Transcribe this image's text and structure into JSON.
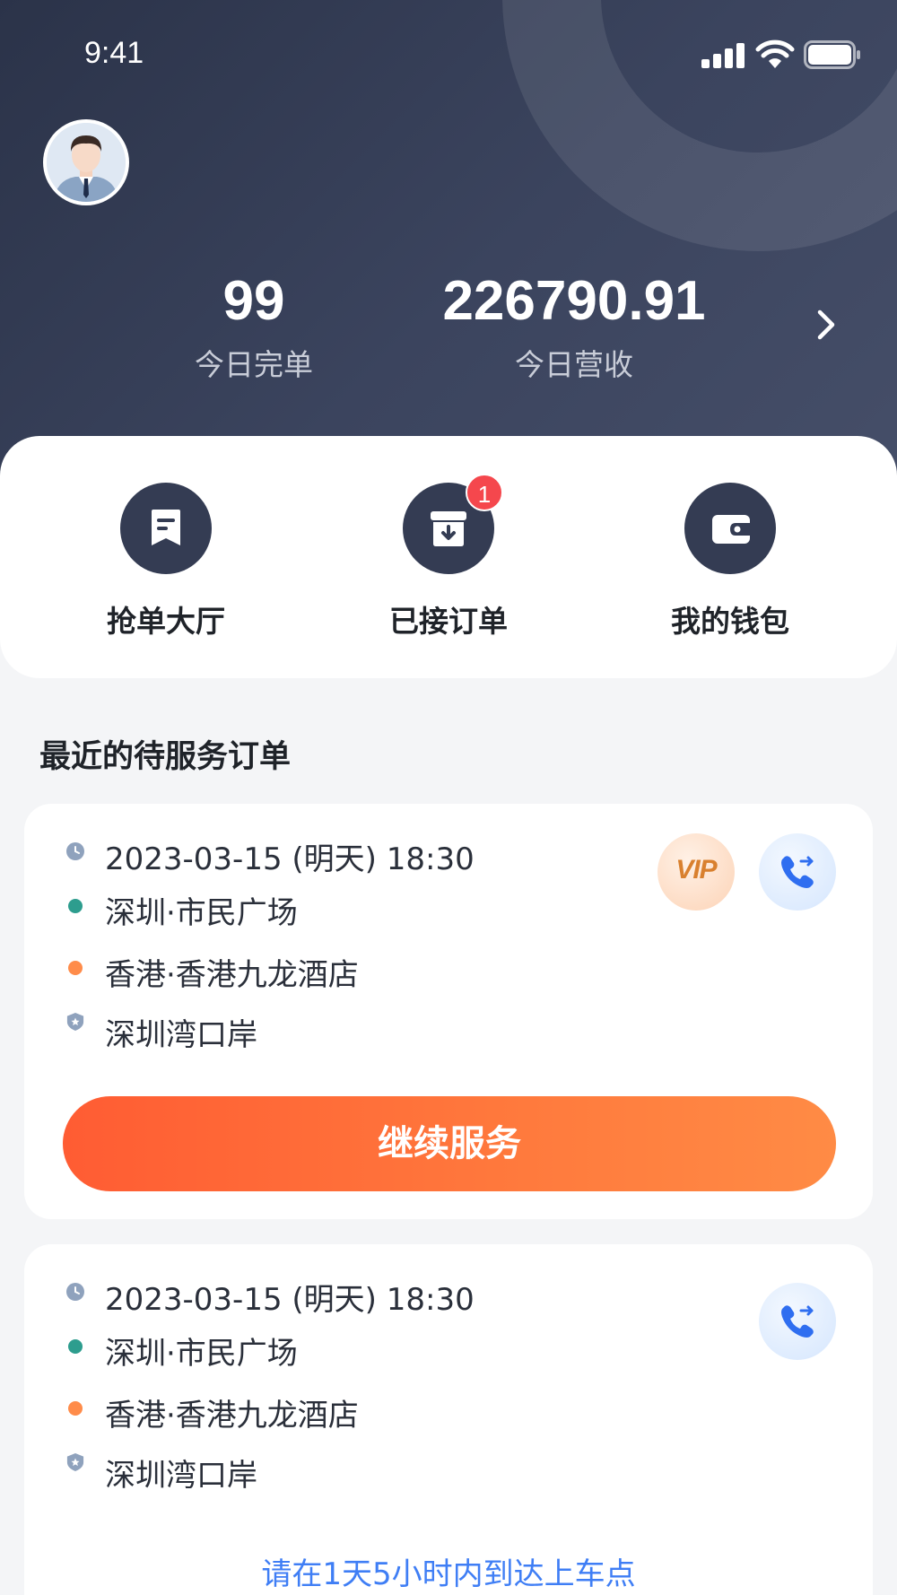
{
  "status_bar": {
    "time": "9:41"
  },
  "stats": {
    "orders_value": "99",
    "orders_label": "今日完单",
    "revenue_value": "226790.91",
    "revenue_label": "今日营收"
  },
  "quick_actions": [
    {
      "label": "抢单大厅",
      "icon": "order-hall-icon"
    },
    {
      "label": "已接订单",
      "icon": "accepted-orders-icon",
      "badge": "1"
    },
    {
      "label": "我的钱包",
      "icon": "wallet-icon"
    }
  ],
  "section_title": "最近的待服务订单",
  "orders": [
    {
      "time": "2023-03-15 (明天) 18:30",
      "from": "深圳·市民广场",
      "to": "香港·香港九龙酒店",
      "port": "深圳湾口岸",
      "vip_label": "VIP",
      "action_label": "继续服务"
    },
    {
      "time": "2023-03-15 (明天) 18:30",
      "from": "深圳·市民广场",
      "to": "香港·香港九龙酒店",
      "port": "深圳湾口岸",
      "hint": "请在1天5小时内到达上车点"
    }
  ],
  "colors": {
    "header_bg": "#2f3750",
    "accent_orange": "#ff6a36",
    "link_blue": "#3f7ef5",
    "badge_red": "#f5474d",
    "from_dot": "#2d9d8e",
    "to_dot": "#ff8c4a"
  }
}
